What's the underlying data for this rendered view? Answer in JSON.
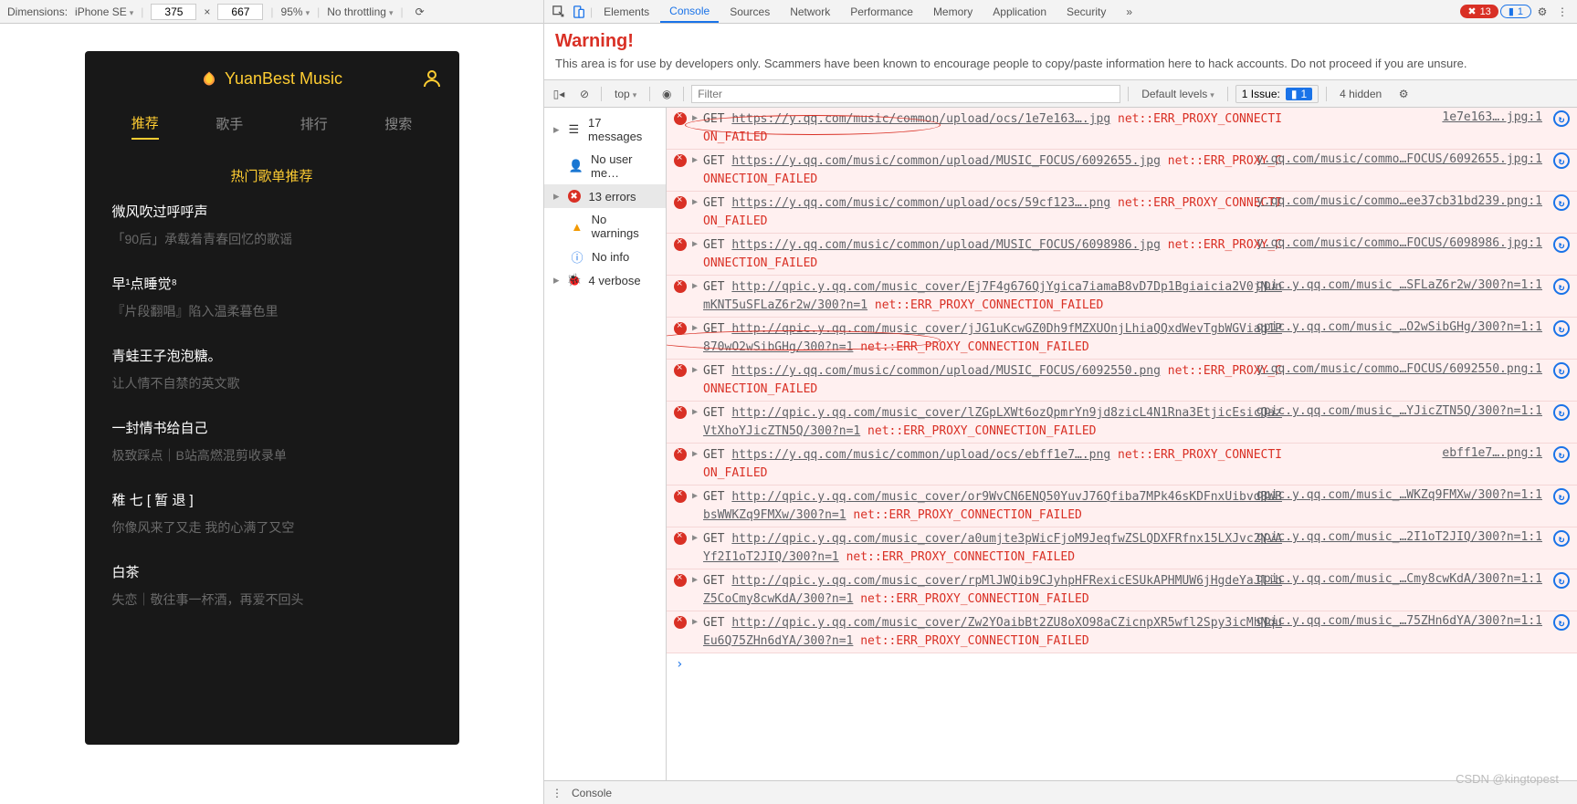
{
  "devicebar": {
    "dimensions_label": "Dimensions:",
    "device": "iPhone SE",
    "width": "375",
    "x": "×",
    "height": "667",
    "zoom": "95%",
    "throttling": "No throttling"
  },
  "app": {
    "title": "YuanBest Music",
    "tabs": [
      "推荐",
      "歌手",
      "排行",
      "搜索"
    ],
    "active_tab": 0,
    "section_title": "热门歌单推荐",
    "songs": [
      {
        "title": "微风吹过呼呼声",
        "sub": "「90后」承载着青春回忆的歌谣"
      },
      {
        "title": "早¹点睡觉⁸",
        "sub": "『片段翻唱』陷入温柔暮色里"
      },
      {
        "title": "青蛙王子泡泡糖。",
        "sub": "让人情不自禁的英文歌"
      },
      {
        "title": "一封情书给自己",
        "sub": "极致踩点｜B站高燃混剪收录单"
      },
      {
        "title": "稚 七 [ 暂 退 ]",
        "sub": "你像风来了又走 我的心满了又空"
      },
      {
        "title": "白茶",
        "sub": "失恋｜敬往事一杯酒，再爱不回头"
      }
    ]
  },
  "devtools": {
    "tabs": [
      "Elements",
      "Console",
      "Sources",
      "Network",
      "Performance",
      "Memory",
      "Application",
      "Security"
    ],
    "active_tab": 1,
    "errors_count": "13",
    "infos_count": "1",
    "warning_title": "Warning!",
    "warning_text": "This area is for use by developers only. Scammers have been known to encourage people to copy/paste information here to hack accounts. Do not proceed if you are unsure.",
    "filter": {
      "context": "top",
      "placeholder": "Filter",
      "levels": "Default levels",
      "issues_label": "1 Issue:",
      "issues_count": "1",
      "hidden": "4 hidden"
    },
    "sidebar": [
      {
        "icon": "list",
        "label": "17 messages"
      },
      {
        "icon": "user",
        "label": "No user me…"
      },
      {
        "icon": "error",
        "label": "13 errors"
      },
      {
        "icon": "warn",
        "label": "No warnings"
      },
      {
        "icon": "info",
        "label": "No info"
      },
      {
        "icon": "bug",
        "label": "4 verbose"
      }
    ],
    "entries": [
      {
        "method": "GET",
        "url": "https://y.qq.com/music/common/upload/ocs/1e7e163….jpg",
        "err": "net::ERR_PROXY_CONNECTION_FAILED",
        "src": "1e7e163….jpg:1"
      },
      {
        "method": "GET",
        "url": "https://y.qq.com/music/common/upload/MUSIC_FOCUS/6092655.jpg",
        "err": "net::ERR_PROXY_CONNECTION_FAILED",
        "src": "y.qq.com/music/commo…FOCUS/6092655.jpg:1"
      },
      {
        "method": "GET",
        "url": "https://y.qq.com/music/common/upload/ocs/59cf123….png",
        "err": "net::ERR_PROXY_CONNECTION_FAILED",
        "src": "y.qq.com/music/commo…ee37cb31bd239.png:1"
      },
      {
        "method": "GET",
        "url": "https://y.qq.com/music/common/upload/MUSIC_FOCUS/6098986.jpg",
        "err": "net::ERR_PROXY_CONNECTION_FAILED",
        "src": "y.qq.com/music/commo…FOCUS/6098986.jpg:1"
      },
      {
        "method": "GET",
        "url": "http://qpic.y.qq.com/music_cover/Ej7F4g676QjYgica7iamaB8vD7Dp1Bgiaicia2V0jNunmKNT5uSFLaZ6r2w/300?n=1",
        "err": "net::ERR_PROXY_CONNECTION_FAILED",
        "src": "qpic.y.qq.com/music_…SFLaZ6r2w/300?n=1:1"
      },
      {
        "method": "GET",
        "url": "http://qpic.y.qq.com/music_cover/jJG1uKcwGZ0Dh9fMZXUOnjLhiaQQxdWevTgbWGViag1P870wO2wSibGHg/300?n=1",
        "err": "net::ERR_PROXY_CONNECTION_FAILED",
        "src": "qpic.y.qq.com/music_…O2wSibGHg/300?n=1:1"
      },
      {
        "method": "GET",
        "url": "https://y.qq.com/music/common/upload/MUSIC_FOCUS/6092550.png",
        "err": "net::ERR_PROXY_CONNECTION_FAILED",
        "src": "y.qq.com/music/commo…FOCUS/6092550.png:1"
      },
      {
        "method": "GET",
        "url": "http://qpic.y.qq.com/music_cover/lZGpLXWt6ozQpmrYn9jd8zicL4N1Rna3EtjicEsicQazVtXhoYJicZTN5Q/300?n=1",
        "err": "net::ERR_PROXY_CONNECTION_FAILED",
        "src": "qpic.y.qq.com/music_…YJicZTN5Q/300?n=1:1"
      },
      {
        "method": "GET",
        "url": "https://y.qq.com/music/common/upload/ocs/ebff1e7….png",
        "err": "net::ERR_PROXY_CONNECTION_FAILED",
        "src": "ebff1e7….png:1"
      },
      {
        "method": "GET",
        "url": "http://qpic.y.qq.com/music_cover/or9WvCN6ENQ50YuvJ76Qfiba7MPk46sKDFnxUibvdBWBbsWWKZq9FMXw/300?n=1",
        "err": "net::ERR_PROXY_CONNECTION_FAILED",
        "src": "qpic.y.qq.com/music_…WKZq9FMXw/300?n=1:1"
      },
      {
        "method": "GET",
        "url": "http://qpic.y.qq.com/music_cover/a0umjte3pWicFjoM9JeqfwZSLQDXFRfnx15LXJvc2YvAYf2I1oT2JIQ/300?n=1",
        "err": "net::ERR_PROXY_CONNECTION_FAILED",
        "src": "qpic.y.qq.com/music_…2I1oT2JIQ/300?n=1:1"
      },
      {
        "method": "GET",
        "url": "http://qpic.y.qq.com/music_cover/rpMlJWQib9CJyhpHFRexicESUkAPHMUW6jHgdeYaJlibZ5CoCmy8cwKdA/300?n=1",
        "err": "net::ERR_PROXY_CONNECTION_FAILED",
        "src": "qpic.y.qq.com/music_…Cmy8cwKdA/300?n=1:1"
      },
      {
        "method": "GET",
        "url": "http://qpic.y.qq.com/music_cover/Zw2YOaibBt2ZU8oXO98aCZicnpXR5wfl2Spy3icMhNquEu6Q75ZHn6dYA/300?n=1",
        "err": "net::ERR_PROXY_CONNECTION_FAILED",
        "src": "qpic.y.qq.com/music_…75ZHn6dYA/300?n=1:1"
      }
    ],
    "drawer_label": "Console"
  },
  "watermark": "CSDN @kingtopest"
}
